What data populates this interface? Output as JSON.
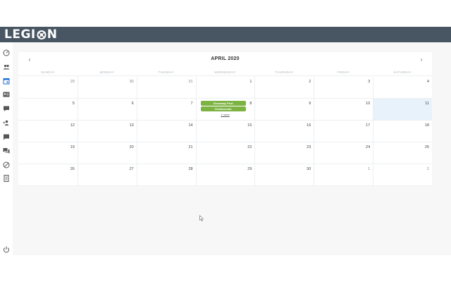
{
  "app": {
    "logo_text_left": "LEGI",
    "logo_text_right": "N",
    "accent_color": "#485663",
    "event_color": "#7cb342",
    "today_color": "#e8f2fb"
  },
  "sidebar": {
    "items": [
      {
        "icon": "dashboard-icon"
      },
      {
        "icon": "users-icon"
      },
      {
        "icon": "calendar-icon"
      },
      {
        "icon": "id-card-icon"
      },
      {
        "icon": "comment-icon"
      },
      {
        "icon": "user-add-icon"
      },
      {
        "icon": "message-icon"
      },
      {
        "icon": "chat-icon"
      },
      {
        "icon": "blocked-icon"
      },
      {
        "icon": "document-icon"
      },
      {
        "icon": "power-icon"
      }
    ]
  },
  "calendar": {
    "title": "APRIL 2020",
    "prev_label": "‹",
    "next_label": "›",
    "weekdays": [
      "SUNDAY",
      "MONDAY",
      "TUESDAY",
      "WEDNESDAY",
      "THURSDAY",
      "FRIDAY",
      "SATURDAY"
    ],
    "weeks": [
      [
        "29",
        "30",
        "31",
        "1",
        "2",
        "3",
        "4"
      ],
      [
        "5",
        "6",
        "7",
        "8",
        "9",
        "10",
        "11"
      ],
      [
        "12",
        "13",
        "14",
        "15",
        "16",
        "17",
        "18"
      ],
      [
        "19",
        "20",
        "21",
        "22",
        "23",
        "24",
        "25"
      ],
      [
        "26",
        "27",
        "28",
        "29",
        "30",
        "1",
        "2"
      ]
    ],
    "events": [
      {
        "label": "Giveaway Post"
      },
      {
        "label": "Clickbounds"
      }
    ],
    "more_link": "1 more"
  }
}
